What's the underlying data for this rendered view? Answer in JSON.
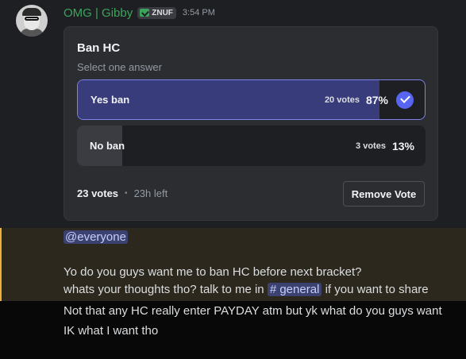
{
  "message": {
    "username": "OMG | Gibby",
    "tag": "ZNUF",
    "timestamp": "3:54 PM",
    "mention": "@everyone",
    "line1": "Yo do you guys want me to ban HC before next bracket?",
    "line2_prefix": "whats your thoughts tho? talk to me in",
    "channel": "# general",
    "line2_suffix": "if you want to share",
    "line3": "Not that any HC really enter PAYDAY atm but yk what do you guys want",
    "line4": "IK what I want tho"
  },
  "poll": {
    "question": "Ban HC",
    "subtitle": "Select one answer",
    "answers": [
      {
        "label": "Yes ban",
        "votes": "20 votes",
        "percent": "87%",
        "fraction": 0.87,
        "selected": true
      },
      {
        "label": "No ban",
        "votes": "3 votes",
        "percent": "13%",
        "fraction": 0.13,
        "selected": false
      }
    ],
    "total_votes": "23 votes",
    "dot": "•",
    "time_left": "23h left",
    "remove_vote_label": "Remove Vote"
  },
  "colors": {
    "username": "#3ba55c",
    "accent": "#5865f2",
    "highlight_border": "#f0b232"
  }
}
